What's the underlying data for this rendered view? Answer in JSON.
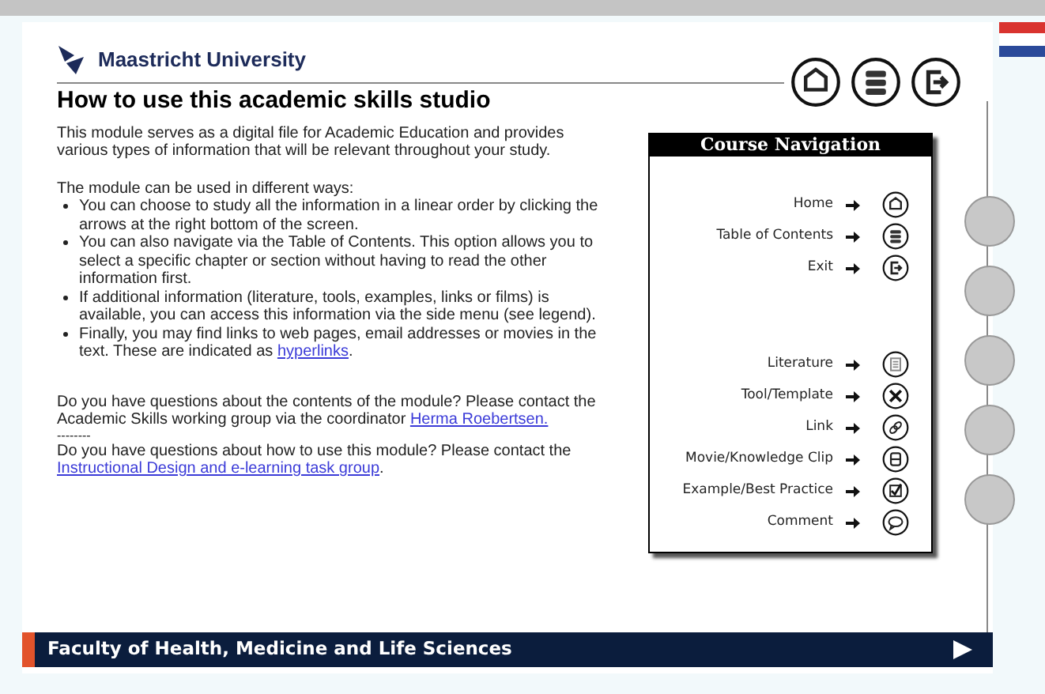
{
  "logo": {
    "text": "Maastricht University"
  },
  "top_buttons": [
    {
      "kind": "home"
    },
    {
      "kind": "contents"
    },
    {
      "kind": "exit"
    }
  ],
  "title": "How to use this academic skills studio",
  "intro": "This module serves as a digital file for Academic Education and provides various types of information that will be relevant throughout your study.",
  "ways_intro": "The module can be used in different ways:",
  "bullets": [
    {
      "text": "You can choose to study all the information in a linear order by clicking the arrows at the right bottom of the screen."
    },
    {
      "text": "You can also navigate via the Table of Contents. This option allows you to select a specific chapter or section without having to read the other information first."
    },
    {
      "text": "If additional information (literature, tools, examples, links or films) is available, you can access this information via the side menu (see legend)."
    },
    {
      "text": "Finally, you may find links to web pages, email addresses or movies in the text. These are indicated as",
      "link": "hyperlinks",
      "after": "."
    }
  ],
  "contact_content": {
    "text": "Do you have questions about the contents of the module? Please contact the Academic Skills working group via the coordinator",
    "link": "Herma Roebertsen."
  },
  "separator": "--------",
  "contact_usage": {
    "text": "Do you have questions about how to use this module? Please contact the",
    "link": "Instructional Design and e-learning task group",
    "after": "."
  },
  "course_navigation": {
    "title": "Course Navigation",
    "groups": [
      [
        {
          "label": "Home",
          "kind": "home"
        },
        {
          "label": "Table of Contents",
          "kind": "contents"
        },
        {
          "label": "Exit",
          "kind": "exit"
        }
      ],
      [
        {
          "label": "Literature",
          "kind": "literature"
        },
        {
          "label": "Tool/Template",
          "kind": "tool"
        },
        {
          "label": "Link",
          "kind": "link"
        },
        {
          "label": "Movie/Knowledge Clip",
          "kind": "movie"
        },
        {
          "label": "Example/Best Practice",
          "kind": "example"
        },
        {
          "label": "Comment",
          "kind": "comment"
        }
      ]
    ]
  },
  "footer": {
    "text": "Faculty of Health, Medicine and Life Sciences"
  }
}
